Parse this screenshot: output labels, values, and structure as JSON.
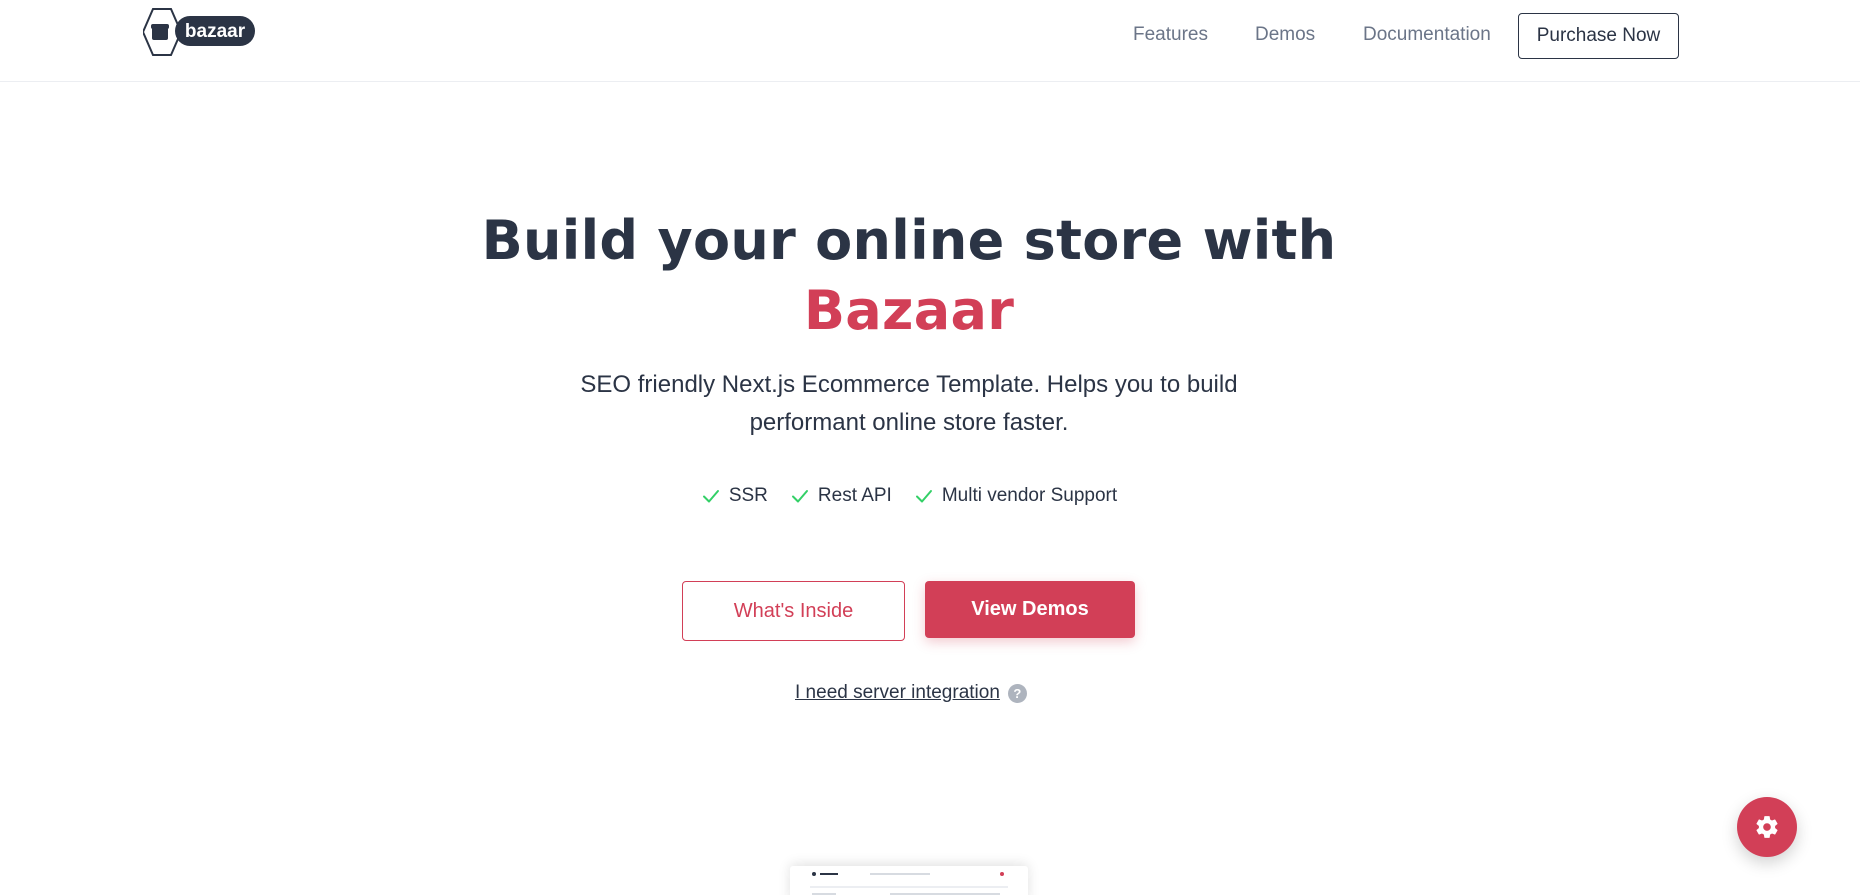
{
  "header": {
    "logo_text": "bazaar",
    "nav": [
      {
        "label": "Features"
      },
      {
        "label": "Demos"
      },
      {
        "label": "Documentation"
      }
    ],
    "purchase_label": "Purchase Now"
  },
  "hero": {
    "title_line1": "Build your online store with",
    "title_brand": "Bazaar",
    "subtitle_line1": "SEO friendly Next.js Ecommerce Template. Helps you to build",
    "subtitle_line2": "performant online store faster.",
    "features": [
      {
        "label": "SSR",
        "icon": "check-icon"
      },
      {
        "label": "Rest API",
        "icon": "check-icon"
      },
      {
        "label": "Multi vendor Support",
        "icon": "check-icon"
      }
    ],
    "primary_outline_label": "What's Inside",
    "primary_solid_label": "View Demos",
    "server_link_label": "I need server integration",
    "help_icon": "?"
  },
  "settings_icon": "gear-icon",
  "colors": {
    "brand": "#d23f57",
    "text": "#2b3445",
    "muted": "#6b7588",
    "check": "#33d067"
  }
}
